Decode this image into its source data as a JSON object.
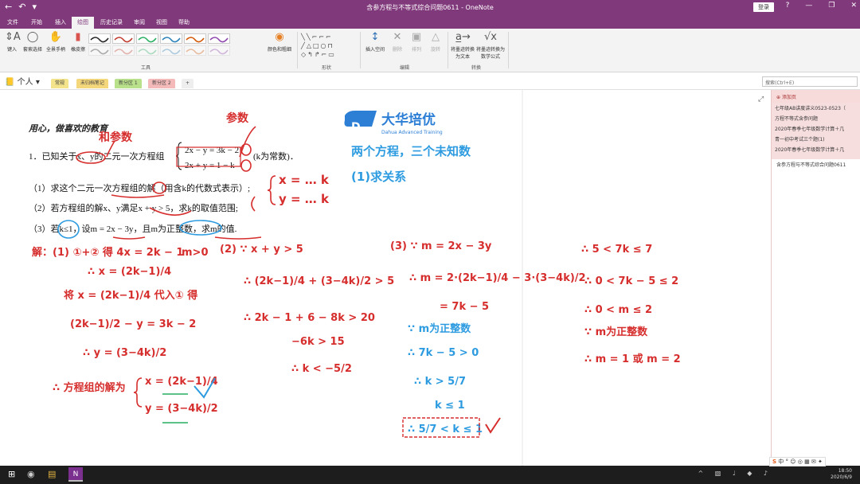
{
  "window": {
    "title": "含参方程与不等式综合问题0611 - OneNote",
    "login_label": "登录",
    "controls": [
      "?",
      "—",
      "❒",
      "✕"
    ]
  },
  "ribbon_tabs": [
    "文件",
    "开始",
    "插入",
    "绘图",
    "历史记录",
    "审阅",
    "视图",
    "帮助"
  ],
  "active_tab": "绘图",
  "ribbon": {
    "tools": [
      "键入",
      "套索选择",
      "全景手柄",
      "橡皮擦"
    ],
    "group_tools": "工具",
    "color_thickness": "颜色和粗细",
    "group_shapes": "形状",
    "edit": [
      "插入空间",
      "删除",
      "排列",
      "旋转"
    ],
    "group_edit": "编辑",
    "convert": [
      "将墨迹转换为文本",
      "将墨迹转换为数学公式"
    ],
    "group_convert": "转换",
    "pen_colors": [
      "#222222",
      "#c0392b",
      "#27ae60",
      "#2980b9",
      "#d35400",
      "#8e44ad",
      "#222222",
      "#c0392b",
      "#27ae60",
      "#2980b9",
      "#d35400",
      "#8e44ad"
    ]
  },
  "notebook": {
    "name": "个人",
    "sections": [
      {
        "label": "常规",
        "color": "#f3e38a"
      },
      {
        "label": "未归档笔记",
        "color": "#f5d77b"
      },
      {
        "label": "新分区 1",
        "color": "#b9e08a"
      },
      {
        "label": "新分区 2",
        "color": "#f4b9b9"
      }
    ],
    "search_placeholder": "搜索(Ctrl+E)"
  },
  "pages_panel": {
    "add_page": "添加页",
    "items": [
      "七年级AB讲度讲义0523-0523（",
      "方程不等式含参问题",
      "2020年春季七年级数学计算＋几",
      "青一初中考试三个题(1)",
      "2020年春季七年级数学计算＋几"
    ],
    "current": "含参方程与不等式综合问题0611"
  },
  "content": {
    "heading": "用心，做喜欢的教育",
    "logo_text": "大华培优",
    "logo_sub": "Dahua Advanced Training",
    "problem_intro": "1．已知关于x、y的二元一次方程组",
    "eq1": "2x − y = 3k − 2",
    "eq2": "2x + y = 1 − k",
    "eq_note": "(k为常数)．",
    "q1": "（1）求这个二元一次方程组的解（用含k的代数式表示）;",
    "q2": "（2）若方程组的解x、y满足x + y > 5，求k的取值范围;",
    "q3": "（3）若k≤1，设m = 2x − 3y，且m为正整数，求m的值."
  },
  "handwriting": {
    "note_top1": "参数",
    "note_top2": "和参数",
    "note_right1": "两个方程，三个未知数",
    "note_right2": "(1)求关系",
    "brace1": "x = … k",
    "brace2": "y = … k",
    "sol_a": "解：(1) ①+② 得 4x = 2k − 1",
    "sol_b": "∴ x = (2k−1)/4",
    "sol_c": "将 x = (2k−1)/4 代入① 得",
    "sol_d": "(2k−1)/2 − y = 3k − 2",
    "sol_e": "∴ y = (3−4k)/2",
    "sol_f": "∴ 方程组的解为",
    "sol_g": "x = (2k−1)/4",
    "sol_h": "y = (3−4k)/2",
    "m_gt0": "m>0",
    "p2_a": "(2) ∵ x + y > 5",
    "p2_b": "∴ (2k−1)/4 + (3−4k)/2 > 5",
    "p2_c": "∴ 2k − 1 + 6 − 8k > 20",
    "p2_d": "−6k > 15",
    "p2_e": "∴ k < −5/2",
    "p3_a": "(3) ∵ m = 2x − 3y",
    "p3_b": "∴ m = 2·(2k−1)/4 − 3·(3−4k)/2",
    "p3_c": "= 7k − 5",
    "p3_d": "∵ m为正整数",
    "p3_e": "∴ 7k − 5 > 0",
    "p3_f": "∴ k > 5/7",
    "p3_g": "k ≤ 1",
    "p3_h": "∴ 5/7 < k ≤ 1",
    "p4_a": "∴ 5 < 7k ≤ 7",
    "p4_b": "∴ 0 < 7k − 5 ≤ 2",
    "p4_c": "∴ 0 < m ≤ 2",
    "p4_d": "∵ m为正整数",
    "p4_e": "∴ m = 1 或 m = 2"
  },
  "taskbar": {
    "time": "18:50",
    "date": "2020/6/9"
  }
}
